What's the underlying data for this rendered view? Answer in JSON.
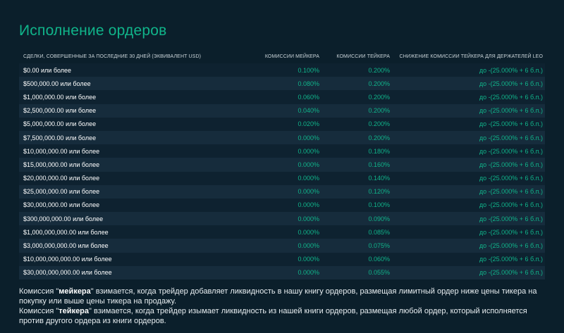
{
  "page": {
    "title": "Исполнение ордеров"
  },
  "table": {
    "headers": {
      "volume": "СДЕЛКИ, СОВЕРШЕННЫЕ ЗА ПОСЛЕДНИЕ 30 ДНЕЙ (ЭКВИВАЛЕНТ USD)",
      "maker": "КОМИССИИ МЕЙКЕРА",
      "taker": "КОМИССИИ ТЕЙКЕРА",
      "discount": "СНИЖЕНИЕ КОМИССИИ ТЕЙКЕРА ДЛЯ ДЕРЖАТЕЛЕЙ LEO"
    },
    "rows": [
      {
        "volume": "$0.00 или более",
        "maker": "0.100%",
        "taker": "0.200%",
        "discount": "до -(25.000% + 6 б.п.)"
      },
      {
        "volume": "$500,000.00 или более",
        "maker": "0.080%",
        "taker": "0.200%",
        "discount": "до -(25.000% + 6 б.п.)"
      },
      {
        "volume": "$1,000,000.00 или более",
        "maker": "0.060%",
        "taker": "0.200%",
        "discount": "до -(25.000% + 6 б.п.)"
      },
      {
        "volume": "$2,500,000.00 или более",
        "maker": "0.040%",
        "taker": "0.200%",
        "discount": "до -(25.000% + 6 б.п.)"
      },
      {
        "volume": "$5,000,000.00 или более",
        "maker": "0.020%",
        "taker": "0.200%",
        "discount": "до -(25.000% + 6 б.п.)"
      },
      {
        "volume": "$7,500,000.00 или более",
        "maker": "0.000%",
        "taker": "0.200%",
        "discount": "до -(25.000% + 6 б.п.)"
      },
      {
        "volume": "$10,000,000.00 или более",
        "maker": "0.000%",
        "taker": "0.180%",
        "discount": "до -(25.000% + 6 б.п.)"
      },
      {
        "volume": "$15,000,000.00 или более",
        "maker": "0.000%",
        "taker": "0.160%",
        "discount": "до -(25.000% + 6 б.п.)"
      },
      {
        "volume": "$20,000,000.00 или более",
        "maker": "0.000%",
        "taker": "0.140%",
        "discount": "до -(25.000% + 6 б.п.)"
      },
      {
        "volume": "$25,000,000.00 или более",
        "maker": "0.000%",
        "taker": "0.120%",
        "discount": "до -(25.000% + 6 б.п.)"
      },
      {
        "volume": "$30,000,000.00 или более",
        "maker": "0.000%",
        "taker": "0.100%",
        "discount": "до -(25.000% + 6 б.п.)"
      },
      {
        "volume": "$300,000,000.00 или более",
        "maker": "0.000%",
        "taker": "0.090%",
        "discount": "до -(25.000% + 6 б.п.)"
      },
      {
        "volume": "$1,000,000,000.00 или более",
        "maker": "0.000%",
        "taker": "0.085%",
        "discount": "до -(25.000% + 6 б.п.)"
      },
      {
        "volume": "$3,000,000,000.00 или более",
        "maker": "0.000%",
        "taker": "0.075%",
        "discount": "до -(25.000% + 6 б.п.)"
      },
      {
        "volume": "$10,000,000,000.00 или более",
        "maker": "0.000%",
        "taker": "0.060%",
        "discount": "до -(25.000% + 6 б.п.)"
      },
      {
        "volume": "$30,000,000,000.00 или более",
        "maker": "0.000%",
        "taker": "0.055%",
        "discount": "до -(25.000% + 6 б.п.)"
      }
    ]
  },
  "notes": {
    "maker": {
      "prefix": "Комиссия \"",
      "term": "мейкера",
      "suffix": "\" взимается, когда трейдер добавляет ликвидность в нашу книгу ордеров, размещая лимитный ордер ниже цены тикера на покупку или выше цены тикера на продажу."
    },
    "taker": {
      "prefix": "Комиссия \"",
      "term": "тейкера",
      "suffix": "\" взимается, когда трейдер изымает ликвидность из нашей книги ордеров, размещая любой ордер, который исполняется против другого ордера из книги ордеров."
    }
  },
  "colors": {
    "background": "#0b1f2b",
    "accent": "#10b48a",
    "row_dark": "#0e2230",
    "row_light": "#162c3c"
  }
}
